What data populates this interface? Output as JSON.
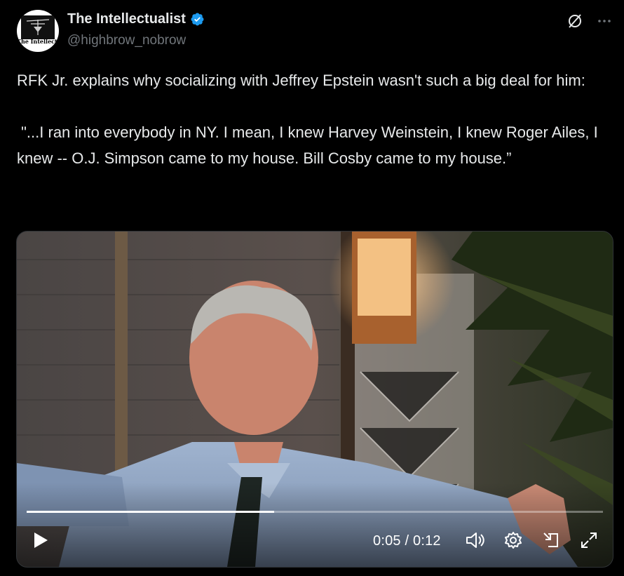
{
  "author": {
    "display_name": "The Intellectualist",
    "handle": "@highbrow_nobrow",
    "avatar_text": "The Intellectualist",
    "verified_color": "#1d9bf0"
  },
  "tweet": {
    "text": "RFK Jr. explains why socializing with Jeffrey Epstein wasn't such a big deal for him:\n\n \"...I ran into everybody in NY. I mean, I knew Harvey Weinstein, I knew Roger Ailes, I knew -- O.J. Simpson came to my house. Bill Cosby came to my house.”"
  },
  "video": {
    "current_time": "0:05",
    "duration": "0:12",
    "time_display": "0:05 / 0:12",
    "progress": 0.43
  },
  "icons": {
    "grok": "grok-icon",
    "more": "more-icon",
    "play": "play-icon",
    "volume": "volume-icon",
    "settings": "settings-icon",
    "minimize": "minimize-icon",
    "fullscreen": "fullscreen-icon"
  },
  "colors": {
    "background": "#000000",
    "text": "#e7e9ea",
    "secondary": "#71767b",
    "accent": "#1d9bf0"
  }
}
